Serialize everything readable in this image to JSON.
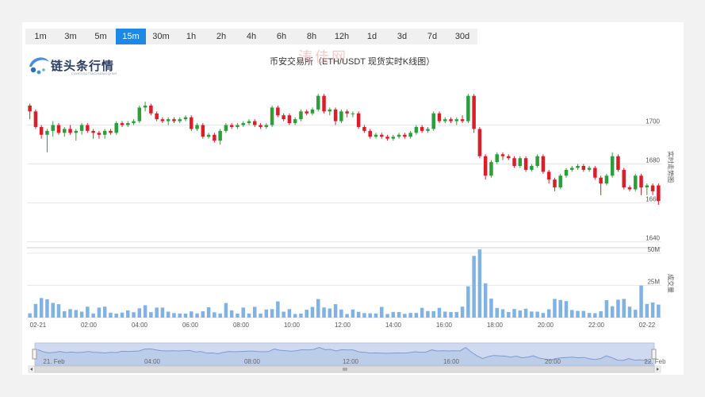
{
  "tabs": [
    "1m",
    "3m",
    "5m",
    "15m",
    "30m",
    "1h",
    "2h",
    "4h",
    "6h",
    "8h",
    "12h",
    "1d",
    "3d",
    "7d",
    "30d"
  ],
  "active_tab": "15m",
  "logo": {
    "name": "链头条行情",
    "sub": "LIANTOUTIAOHANGQING"
  },
  "watermark": "涛佳网",
  "chart_title": "币安交易所（ETH/USDT 现货实时K线图）",
  "colors": {
    "up": "#2e9e3a",
    "down": "#d9202a",
    "volume": "#7fb2e5",
    "accent": "#1e88e5"
  },
  "chart_data": {
    "type": "candlestick",
    "price_axis": {
      "label": "实时走势图",
      "ticks": [
        1640,
        1660,
        1680,
        1700
      ],
      "ylim": [
        1637,
        1721
      ]
    },
    "volume_axis": {
      "label": "成交量",
      "ticks": [
        "25M",
        "50M"
      ],
      "ylim": [
        0,
        53
      ]
    },
    "x_ticks": [
      "02-21",
      "02:00",
      "04:00",
      "06:00",
      "08:00",
      "10:00",
      "12:00",
      "14:00",
      "16:00",
      "18:00",
      "20:00",
      "22:00",
      "02-22"
    ],
    "navigator": {
      "labels": [
        "21. Feb",
        "04:00",
        "08:00",
        "12:00",
        "16:00",
        "20:00",
        "22. Feb"
      ]
    },
    "candles": [
      [
        1710,
        1707,
        1711,
        1703,
        3.3
      ],
      [
        1707,
        1699,
        1708,
        1698,
        10.6
      ],
      [
        1699,
        1695,
        1700,
        1693,
        15.2
      ],
      [
        1695,
        1697,
        1698,
        1686,
        14.2
      ],
      [
        1697,
        1700,
        1702,
        1694,
        11.4
      ],
      [
        1700,
        1696,
        1701,
        1695,
        10.4
      ],
      [
        1696,
        1698,
        1699,
        1694,
        4.9
      ],
      [
        1698,
        1696,
        1700,
        1695,
        6.6
      ],
      [
        1696,
        1697,
        1698,
        1692,
        5.9
      ],
      [
        1697,
        1700,
        1701,
        1695,
        4.6
      ],
      [
        1700,
        1697,
        1701,
        1696,
        8.5
      ],
      [
        1697,
        1696,
        1698,
        1693,
        3.2
      ],
      [
        1696,
        1695,
        1697,
        1693,
        7.8
      ],
      [
        1695,
        1697,
        1698,
        1693,
        8.5
      ],
      [
        1697,
        1696,
        1698,
        1695,
        3.8
      ],
      [
        1696,
        1701,
        1702,
        1695,
        3.1
      ],
      [
        1701,
        1700,
        1702,
        1699,
        3.9
      ],
      [
        1700,
        1701,
        1702,
        1699,
        5.6
      ],
      [
        1701,
        1702,
        1703,
        1700,
        4.2
      ],
      [
        1702,
        1709,
        1710,
        1701,
        7.2
      ],
      [
        1709,
        1710,
        1712,
        1707,
        9.6
      ],
      [
        1710,
        1706,
        1711,
        1705,
        4.2
      ],
      [
        1706,
        1703,
        1707,
        1702,
        7.8
      ],
      [
        1703,
        1702,
        1704,
        1701,
        7.8
      ],
      [
        1702,
        1703,
        1704,
        1700,
        4.6
      ],
      [
        1703,
        1702,
        1704,
        1701,
        3.5
      ],
      [
        1702,
        1703,
        1704,
        1701,
        3.2
      ],
      [
        1703,
        1704,
        1705,
        1702,
        3.1
      ],
      [
        1704,
        1698,
        1705,
        1697,
        4.8
      ],
      [
        1698,
        1700,
        1701,
        1697,
        3.2
      ],
      [
        1700,
        1694,
        1701,
        1693,
        4.9
      ],
      [
        1694,
        1695,
        1696,
        1693,
        8.0
      ],
      [
        1695,
        1692,
        1696,
        1691,
        4.1
      ],
      [
        1692,
        1697,
        1698,
        1690,
        3.2
      ],
      [
        1697,
        1700,
        1701,
        1696,
        11.3
      ],
      [
        1700,
        1699,
        1701,
        1698,
        5.6
      ],
      [
        1699,
        1700,
        1701,
        1698,
        3.1
      ],
      [
        1700,
        1701,
        1702,
        1699,
        7.8
      ],
      [
        1701,
        1702,
        1703,
        1700,
        3.2
      ],
      [
        1702,
        1700,
        1703,
        1699,
        8.4
      ],
      [
        1700,
        1699,
        1701,
        1698,
        3.1
      ],
      [
        1699,
        1700,
        1701,
        1698,
        6.3
      ],
      [
        1700,
        1709,
        1710,
        1699,
        6.6
      ],
      [
        1709,
        1705,
        1710,
        1704,
        12.6
      ],
      [
        1705,
        1703,
        1706,
        1702,
        4.6
      ],
      [
        1705,
        1701,
        1706,
        1700,
        6.6
      ],
      [
        1701,
        1703,
        1704,
        1700,
        2.8
      ],
      [
        1703,
        1707,
        1708,
        1702,
        3.1
      ],
      [
        1707,
        1706,
        1708,
        1705,
        6.1
      ],
      [
        1706,
        1708,
        1709,
        1705,
        8.3
      ],
      [
        1708,
        1715,
        1716,
        1707,
        14.4
      ],
      [
        1715,
        1707,
        1716,
        1706,
        7.9
      ],
      [
        1707,
        1708,
        1709,
        1705,
        7.1
      ],
      [
        1708,
        1702,
        1709,
        1700,
        10.4
      ],
      [
        1702,
        1707,
        1708,
        1701,
        6.3
      ],
      [
        1707,
        1706,
        1708,
        1704,
        2.8
      ],
      [
        1706,
        1706,
        1707,
        1704,
        6.3
      ],
      [
        1706,
        1699,
        1707,
        1698,
        4.5
      ],
      [
        1699,
        1697,
        1700,
        1696,
        3.5
      ],
      [
        1697,
        1694,
        1698,
        1693,
        3.3
      ],
      [
        1694,
        1695,
        1696,
        1693,
        3.2
      ],
      [
        1695,
        1694,
        1696,
        1693,
        8.3
      ],
      [
        1694,
        1693,
        1695,
        1692,
        2.8
      ],
      [
        1693,
        1694,
        1695,
        1692,
        4.4
      ],
      [
        1694,
        1695,
        1696,
        1693,
        4.3
      ],
      [
        1695,
        1694,
        1696,
        1693,
        2.9
      ],
      [
        1694,
        1696,
        1697,
        1693,
        3.6
      ],
      [
        1696,
        1699,
        1700,
        1695,
        3.6
      ],
      [
        1699,
        1697,
        1700,
        1696,
        7.6
      ],
      [
        1697,
        1698,
        1699,
        1696,
        5.1
      ],
      [
        1698,
        1706,
        1707,
        1697,
        5.0
      ],
      [
        1706,
        1702,
        1707,
        1701,
        7.6
      ],
      [
        1702,
        1703,
        1704,
        1701,
        4.6
      ],
      [
        1703,
        1702,
        1704,
        1701,
        4.3
      ],
      [
        1702,
        1703,
        1704,
        1700,
        4.3
      ],
      [
        1703,
        1702,
        1705,
        1701,
        8.5
      ],
      [
        1702,
        1715,
        1716,
        1701,
        24.3
      ],
      [
        1715,
        1698,
        1716,
        1696,
        47.9
      ],
      [
        1698,
        1684,
        1699,
        1683,
        52.9
      ],
      [
        1684,
        1674,
        1685,
        1672,
        26.6
      ],
      [
        1674,
        1681,
        1682,
        1673,
        14.7
      ],
      [
        1681,
        1685,
        1686,
        1680,
        7.5
      ],
      [
        1685,
        1684,
        1686,
        1682,
        6.5
      ],
      [
        1684,
        1683,
        1685,
        1682,
        4.3
      ],
      [
        1683,
        1679,
        1684,
        1678,
        6.7
      ],
      [
        1679,
        1683,
        1684,
        1678,
        5.5
      ],
      [
        1683,
        1677,
        1684,
        1676,
        6.9
      ],
      [
        1677,
        1679,
        1680,
        1676,
        4.7
      ],
      [
        1679,
        1684,
        1685,
        1678,
        4.6
      ],
      [
        1684,
        1676,
        1685,
        1675,
        3.6
      ],
      [
        1676,
        1672,
        1677,
        1670,
        6.5
      ],
      [
        1672,
        1668,
        1673,
        1666,
        14.5
      ],
      [
        1668,
        1674,
        1675,
        1667,
        13.7
      ],
      [
        1674,
        1677,
        1678,
        1673,
        12.8
      ],
      [
        1677,
        1678,
        1679,
        1676,
        5.9
      ],
      [
        1678,
        1679,
        1680,
        1677,
        5.2
      ],
      [
        1679,
        1677,
        1680,
        1676,
        5.2
      ],
      [
        1677,
        1678,
        1679,
        1676,
        3.6
      ],
      [
        1678,
        1673,
        1679,
        1672,
        3.4
      ],
      [
        1673,
        1670,
        1674,
        1664,
        4.9
      ],
      [
        1670,
        1674,
        1675,
        1669,
        13.5
      ],
      [
        1674,
        1684,
        1686,
        1673,
        8.8
      ],
      [
        1684,
        1677,
        1685,
        1676,
        13.9
      ],
      [
        1677,
        1668,
        1678,
        1667,
        14.5
      ],
      [
        1668,
        1667,
        1669,
        1666,
        8.5
      ],
      [
        1667,
        1674,
        1675,
        1666,
        6.1
      ],
      [
        1674,
        1668,
        1675,
        1664,
        24.9
      ],
      [
        1668,
        1669,
        1670,
        1664,
        10.6
      ],
      [
        1669,
        1666,
        1670,
        1664,
        11.8
      ],
      [
        1669,
        1661,
        1670,
        1659,
        10.1
      ]
    ]
  }
}
